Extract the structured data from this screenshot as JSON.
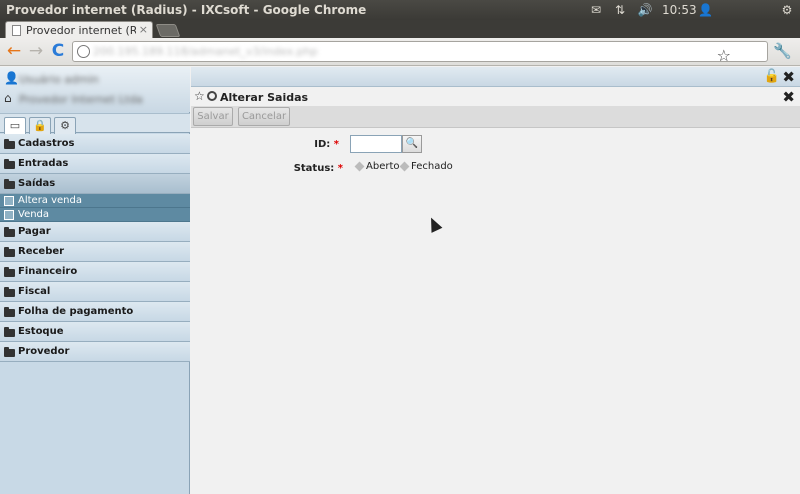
{
  "os": {
    "window_title": "Provedor internet (Radius) - IXCsoft - Google Chrome",
    "clock": "10:53",
    "icons": [
      "mail-icon",
      "network-icon",
      "volume-icon",
      "user-icon",
      "settings-gear-icon"
    ]
  },
  "browser": {
    "tab_title": "Provedor internet (Radius",
    "tab_close": "×",
    "url": "200.195.189.118/admanet_v3/index.php",
    "icons": {
      "back": "←",
      "forward": "→",
      "reload": "C",
      "star": "☆",
      "wrench": "🔧"
    }
  },
  "sidebar": {
    "user_name": "Usuário admin",
    "company_name": "Provedor Internet Ltda",
    "tabs": [
      {
        "name": "window",
        "glyph": "▭"
      },
      {
        "name": "lock",
        "glyph": "🔒"
      },
      {
        "name": "settings",
        "glyph": "⚙"
      }
    ],
    "menu": [
      {
        "label": "Cadastros"
      },
      {
        "label": "Entradas"
      },
      {
        "label": "Saídas",
        "open": true,
        "sub": [
          "Altera venda",
          "Venda"
        ]
      },
      {
        "label": "Pagar"
      },
      {
        "label": "Receber"
      },
      {
        "label": "Financeiro"
      },
      {
        "label": "Fiscal"
      },
      {
        "label": "Folha de pagamento"
      },
      {
        "label": "Estoque"
      },
      {
        "label": "Provedor"
      }
    ]
  },
  "main": {
    "title": "Alterar Saidas",
    "buttons": {
      "save": "Salvar",
      "cancel": "Cancelar"
    },
    "form": {
      "id_label": "ID:",
      "status_label": "Status:",
      "required_mark": "*",
      "id_value": "",
      "status_options": [
        "Aberto",
        "Fechado"
      ]
    },
    "close_glyph": "✖"
  },
  "colors": {
    "accent": "#5e8aa2",
    "sidebar_bg": "#c8d9e6",
    "required": "#dd0000"
  }
}
